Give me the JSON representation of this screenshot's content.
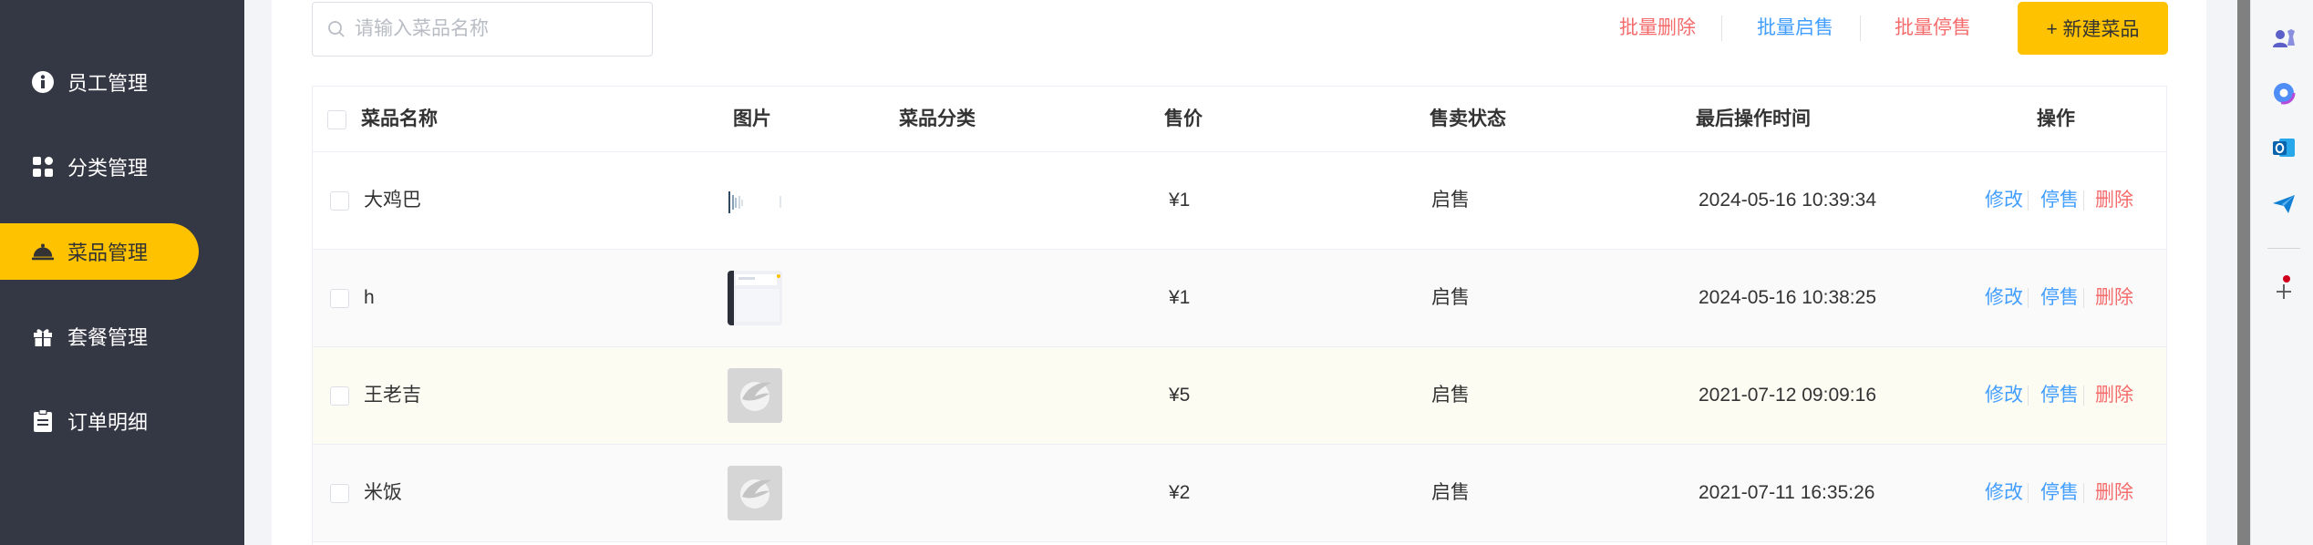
{
  "sidebar": {
    "items": [
      {
        "label": "员工管理",
        "icon": "info-icon"
      },
      {
        "label": "分类管理",
        "icon": "grid-icon"
      },
      {
        "label": "菜品管理",
        "icon": "dish-icon",
        "active": true
      },
      {
        "label": "套餐管理",
        "icon": "gift-icon"
      },
      {
        "label": "订单明细",
        "icon": "clipboard-icon"
      }
    ]
  },
  "toolbar": {
    "search_placeholder": "请输入菜品名称",
    "batch_delete": "批量删除",
    "batch_enable": "批量启售",
    "batch_disable": "批量停售",
    "new_dish": "+ 新建菜品"
  },
  "table": {
    "headers": {
      "name": "菜品名称",
      "image": "图片",
      "category": "菜品分类",
      "price": "售价",
      "status": "售卖状态",
      "updated": "最后操作时间",
      "actions": "操作"
    },
    "rows": [
      {
        "name": "大鸡巴",
        "category": "",
        "price": "¥1",
        "status": "启售",
        "updated": "2024-05-16 10:39:34",
        "image": "photo-sketch"
      },
      {
        "name": "h",
        "category": "",
        "price": "¥1",
        "status": "启售",
        "updated": "2024-05-16 10:38:25",
        "image": "screenshot-thumbnail"
      },
      {
        "name": "王老吉",
        "category": "",
        "price": "¥5",
        "status": "启售",
        "updated": "2021-07-12 09:09:16",
        "image": "placeholder-logo"
      },
      {
        "name": "米饭",
        "category": "",
        "price": "¥2",
        "status": "启售",
        "updated": "2021-07-11 16:35:26",
        "image": "placeholder-logo"
      }
    ],
    "row_actions": {
      "edit": "修改",
      "disable": "停售",
      "delete": "删除"
    }
  },
  "colors": {
    "sidebar_bg": "#343744",
    "accent": "#ffc200",
    "link_blue": "#419eff",
    "danger_red": "#f56c6c"
  },
  "right_panel": {
    "icons": [
      "user-chess-icon",
      "copilot-icon",
      "outlook-icon",
      "send-icon",
      "add-icon"
    ]
  }
}
